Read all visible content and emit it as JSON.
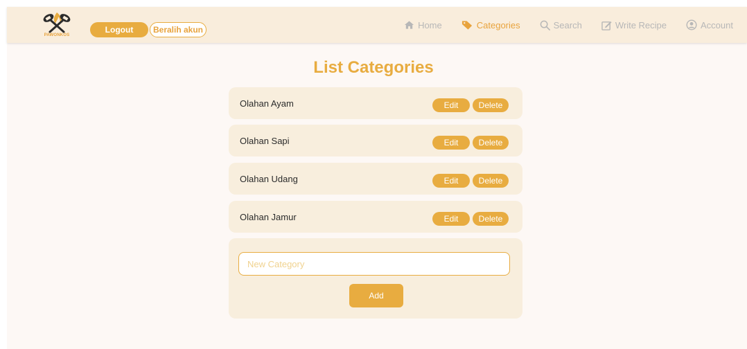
{
  "brand": {
    "name": "PAWONKOS"
  },
  "header": {
    "logout_label": "Logout",
    "switch_label": "Beralih akun"
  },
  "nav": {
    "items": [
      {
        "label": "Home",
        "icon": "home-icon",
        "active": false
      },
      {
        "label": "Categories",
        "icon": "tag-icon",
        "active": true
      },
      {
        "label": "Search",
        "icon": "search-icon",
        "active": false
      },
      {
        "label": "Write Recipe",
        "icon": "edit-icon",
        "active": false
      },
      {
        "label": "Account",
        "icon": "user-circle-icon",
        "active": false
      }
    ]
  },
  "main": {
    "title": "List Categories",
    "categories": [
      {
        "name": "Olahan Ayam",
        "edit_label": "Edit",
        "delete_label": "Delete"
      },
      {
        "name": "Olahan Sapi",
        "edit_label": "Edit",
        "delete_label": "Delete"
      },
      {
        "name": "Olahan Udang",
        "edit_label": "Edit",
        "delete_label": "Delete"
      },
      {
        "name": "Olahan Jamur",
        "edit_label": "Edit",
        "delete_label": "Delete"
      }
    ],
    "new_category": {
      "placeholder": "New Category",
      "value": ""
    },
    "add_label": "Add"
  },
  "colors": {
    "accent": "#e8ac40",
    "navbar_bg": "#f9eddc",
    "card_bg": "#f8eedd",
    "page_bg": "#fdf8f5",
    "inactive_nav": "#b7b7b7"
  }
}
